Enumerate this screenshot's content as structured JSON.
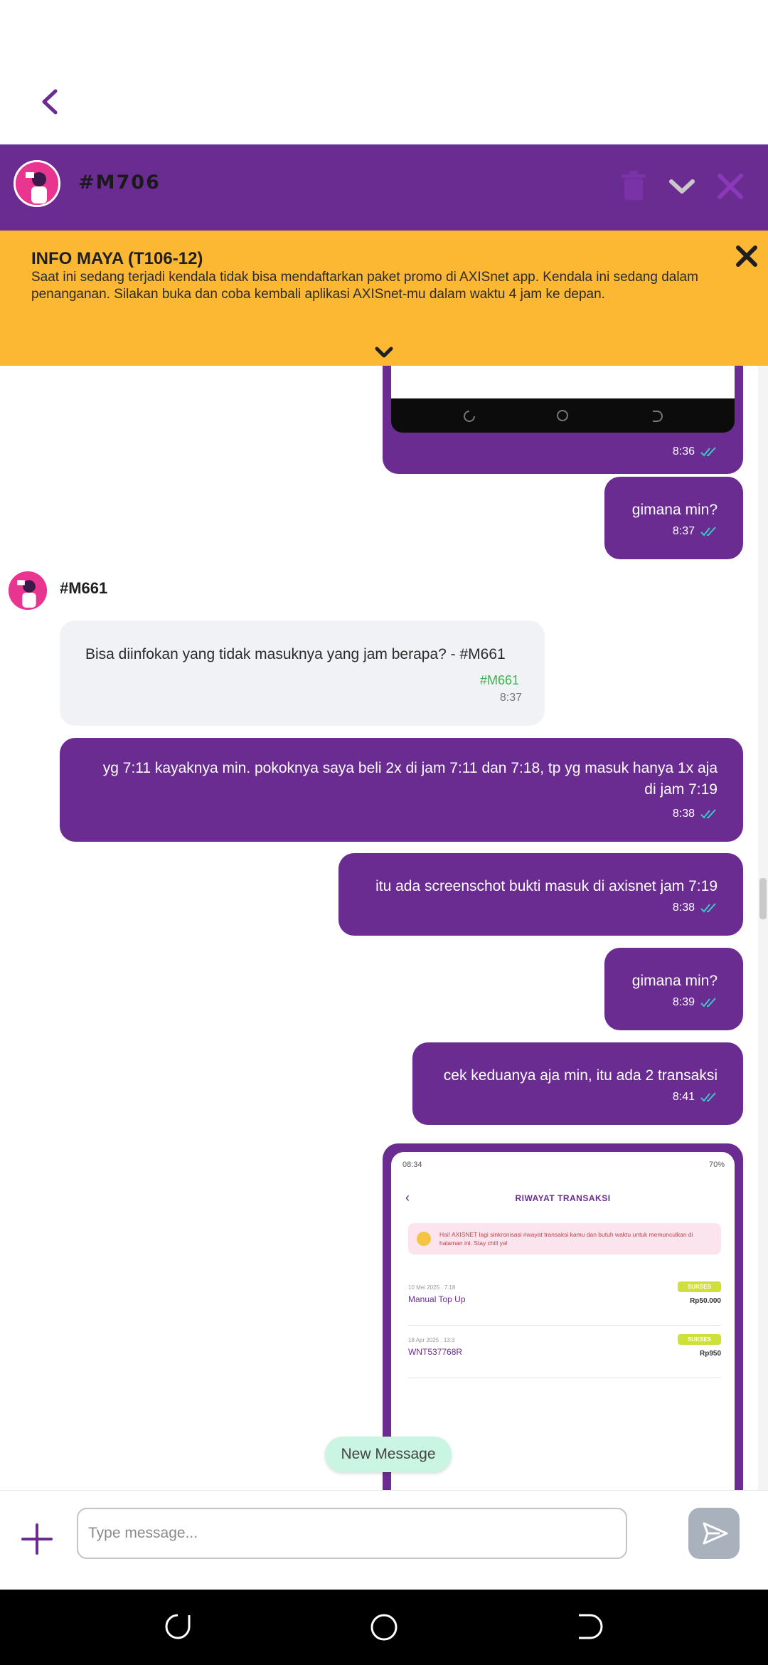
{
  "header": {
    "title": "#M706",
    "icons": [
      "trash-icon",
      "chevron-down-icon",
      "close-icon"
    ]
  },
  "info_banner": {
    "title": "INFO MAYA (T106-12)",
    "text": "Saat ini sedang terjadi kendala tidak bisa mendaftarkan paket promo di AXISnet app. Kendala ini sedang dalam penanganan. Silakan buka dan coba kembali aplikasi AXISnet-mu dalam waktu 4 jam ke depan."
  },
  "messages": {
    "img_top_time": "8:36",
    "m1": {
      "text": "gimana min?",
      "time": "8:37"
    },
    "agent": {
      "name": "#M661",
      "text": "Bisa diinfokan yang tidak masuknya yang jam berapa? - #M661",
      "tag": "#M661",
      "time": "8:37"
    },
    "m2": {
      "line1": "yg 7:11 kayaknya min. pokoknya saya beli 2x di jam 7:11 dan 7:18, tp yg masuk hanya 1x aja",
      "line2": "di jam 7:19",
      "time": "8:38"
    },
    "m3": {
      "text": "itu ada screenschot bukti masuk di axisnet jam 7:19",
      "time": "8:38"
    },
    "m4": {
      "text": "gimana min?",
      "time": "8:39"
    },
    "m5": {
      "text": "cek keduanya aja min, itu ada 2 transaksi",
      "time": "8:41"
    }
  },
  "screenshot": {
    "status_time": "08:34",
    "status_right": "70%",
    "title": "RIWAYAT TRANSAKSI",
    "note": "Hai! AXISNET lagi sinkronisasi riwayat transaksi kamu dan butuh waktu untuk memunculkan di halaman ini. Stay chill ya!",
    "rows": [
      {
        "date": "10 Mei 2025 . 7:18",
        "name": "Manual Top Up",
        "status": "SUKSES",
        "amount": "Rp50.000"
      },
      {
        "date": "18 Apr 2025 . 13:3",
        "name": "WNT537768R",
        "status": "SUKSES",
        "amount": "Rp950"
      }
    ]
  },
  "new_message_label": "New Message",
  "composer": {
    "placeholder": "Type message..."
  },
  "colors": {
    "brand_purple": "#6a2c91",
    "banner_yellow": "#fdb833",
    "read_tick": "#3cc8c8",
    "agent_tag": "#3bb54a"
  }
}
